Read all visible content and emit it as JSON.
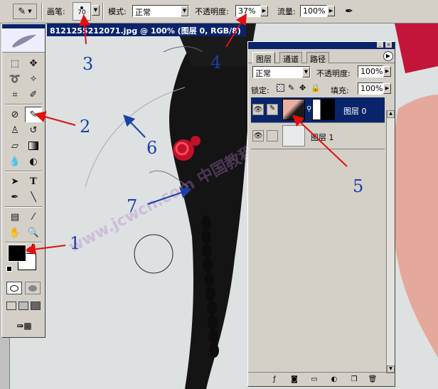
{
  "options_bar": {
    "brush_label": "画笔:",
    "brush_size": "70",
    "mode_label": "模式:",
    "mode_value": "正常",
    "opacity_label": "不透明度:",
    "opacity_value": "37%",
    "flow_label": "流量:",
    "flow_value": "100%"
  },
  "document": {
    "title": "8121255212071.jpg @ 100% (图层 0, RGB/8)"
  },
  "layers_panel": {
    "tabs": [
      "图层",
      "通道",
      "路径"
    ],
    "blend_mode": "正常",
    "opacity_label": "不透明度:",
    "opacity_value": "100%",
    "lock_label": "锁定:",
    "fill_label": "填充:",
    "fill_value": "100%",
    "layers": [
      {
        "name": "图层 0",
        "selected": true
      },
      {
        "name": "图层 1",
        "selected": false
      }
    ]
  },
  "annotations": [
    "1",
    "2",
    "3",
    "4",
    "5",
    "6",
    "7"
  ],
  "watermark": "www.jcwcn.com 中国教程网 祁连山原创教程",
  "colors": {
    "accent_blue": "#0a246a",
    "arrow_red": "#e01010",
    "arrow_blue": "#1a3fa8"
  }
}
